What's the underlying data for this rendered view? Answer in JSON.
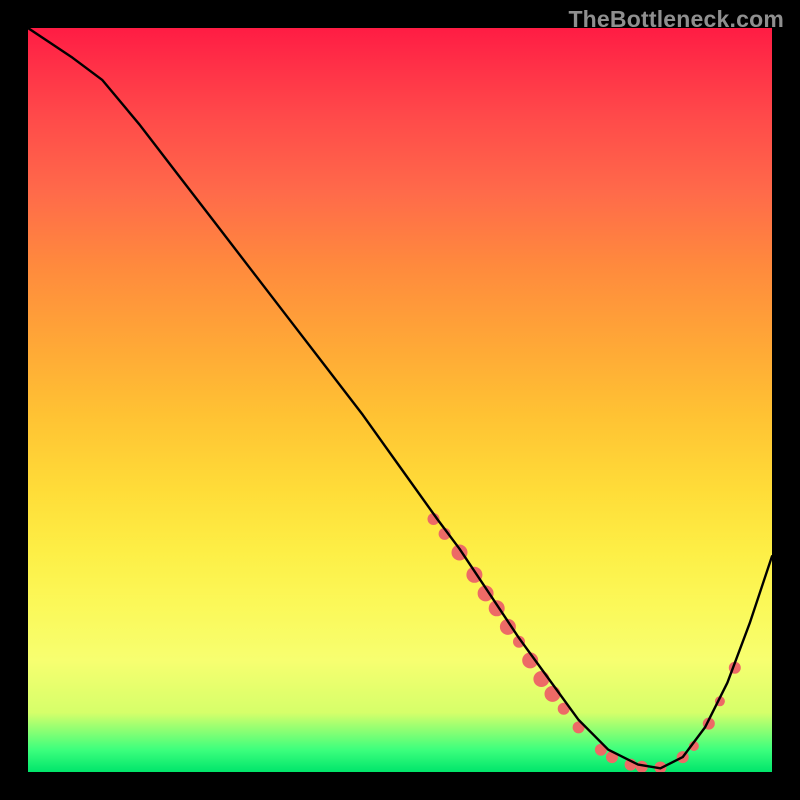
{
  "watermark": "TheBottleneck.com",
  "chart_data": {
    "type": "line",
    "title": "",
    "xlabel": "",
    "ylabel": "",
    "xlim": [
      0,
      100
    ],
    "ylim": [
      0,
      100
    ],
    "series": [
      {
        "name": "bottleneck-curve",
        "x": [
          0,
          3,
          6,
          10,
          15,
          20,
          25,
          30,
          35,
          40,
          45,
          50,
          55,
          58,
          62,
          66,
          70,
          74,
          78,
          82,
          85,
          88,
          91,
          94,
          97,
          100
        ],
        "y": [
          100,
          98,
          96,
          93,
          87,
          80.5,
          74,
          67.5,
          61,
          54.5,
          48,
          41,
          34,
          30,
          24,
          18,
          12.5,
          7,
          3,
          1,
          0.5,
          2,
          6,
          12,
          20,
          29
        ]
      }
    ],
    "markers": {
      "name": "highlighted-points",
      "color": "#ed6a66",
      "points": [
        {
          "x": 54.5,
          "y": 34,
          "r": 6
        },
        {
          "x": 56,
          "y": 32,
          "r": 6
        },
        {
          "x": 58,
          "y": 29.5,
          "r": 8
        },
        {
          "x": 60,
          "y": 26.5,
          "r": 8
        },
        {
          "x": 61.5,
          "y": 24,
          "r": 8
        },
        {
          "x": 63,
          "y": 22,
          "r": 8
        },
        {
          "x": 64.5,
          "y": 19.5,
          "r": 8
        },
        {
          "x": 66,
          "y": 17.5,
          "r": 6
        },
        {
          "x": 67.5,
          "y": 15,
          "r": 8
        },
        {
          "x": 69,
          "y": 12.5,
          "r": 8
        },
        {
          "x": 70.5,
          "y": 10.5,
          "r": 8
        },
        {
          "x": 72,
          "y": 8.5,
          "r": 6
        },
        {
          "x": 74,
          "y": 6,
          "r": 6
        },
        {
          "x": 77,
          "y": 3,
          "r": 6
        },
        {
          "x": 78.5,
          "y": 2,
          "r": 6
        },
        {
          "x": 81,
          "y": 1,
          "r": 6
        },
        {
          "x": 82.5,
          "y": 0.7,
          "r": 6
        },
        {
          "x": 85,
          "y": 0.6,
          "r": 6
        },
        {
          "x": 88,
          "y": 2,
          "r": 6
        },
        {
          "x": 89.5,
          "y": 3.5,
          "r": 5
        },
        {
          "x": 91.5,
          "y": 6.5,
          "r": 6
        },
        {
          "x": 93,
          "y": 9.5,
          "r": 5
        },
        {
          "x": 95,
          "y": 14,
          "r": 6
        }
      ]
    }
  }
}
